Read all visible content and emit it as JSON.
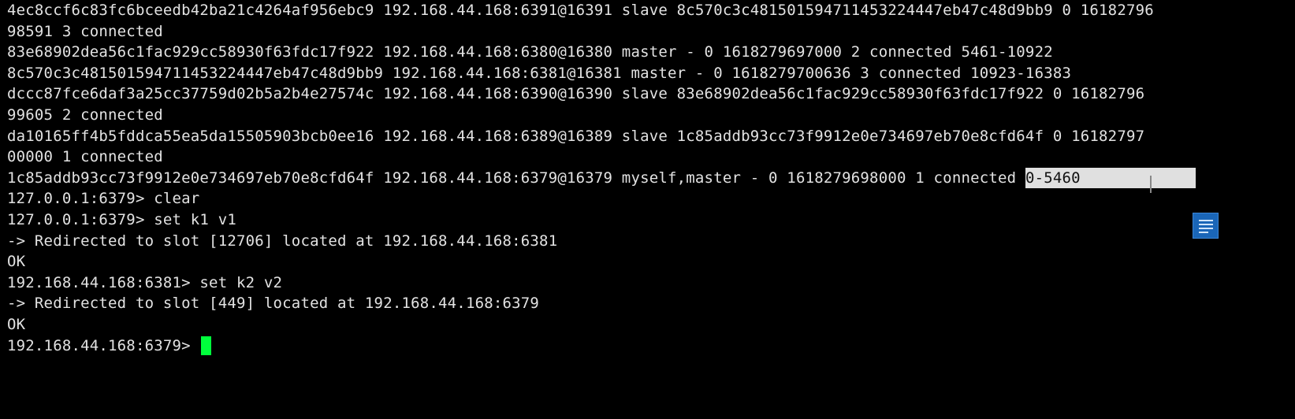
{
  "terminal": {
    "lines": [
      "4ec8ccf6c83fc6bceedb42ba21c4264af956ebc9 192.168.44.168:6391@16391 slave 8c570c3c481501594711453224447eb47c48d9bb9 0 16182796",
      "98591 3 connected",
      "83e68902dea56c1fac929cc58930f63fdc17f922 192.168.44.168:6380@16380 master - 0 1618279697000 2 connected 5461-10922",
      "8c570c3c481501594711453224447eb47c48d9bb9 192.168.44.168:6381@16381 master - 0 1618279700636 3 connected 10923-16383",
      "dccc87fce6daf3a25cc37759d02b5a2b4e27574c 192.168.44.168:6390@16390 slave 83e68902dea56c1fac929cc58930f63fdc17f922 0 16182796",
      "99605 2 connected",
      "da10165ff4b5fddca55ea5da15505903bcb0ee16 192.168.44.168:6389@16389 slave 1c85addb93cc73f9912e0e734697eb70e8cfd64f 0 16182797",
      "00000 1 connected"
    ],
    "myself_line_prefix": "1c85addb93cc73f9912e0e734697eb70e8cfd64f 192.168.44.168:6379@16379 myself,master - 0 1618279698000 1 connected ",
    "selected_text": "0-5460",
    "lines_after": [
      "127.0.0.1:6379> clear",
      "127.0.0.1:6379> set k1 v1",
      "-> Redirected to slot [12706] located at 192.168.44.168:6381",
      "OK",
      "192.168.44.168:6381> set k2 v2",
      "-> Redirected to slot [449] located at 192.168.44.168:6379",
      "OK"
    ],
    "prompt": "192.168.44.168:6379> ",
    "cursor_color": "#00ff3c",
    "background_color": "#000000",
    "text_color": "#e2e2e2",
    "selection_color": "#e0e0e0"
  },
  "overlay": {
    "icon": "notes-icon",
    "icon_color": "#1a66b8"
  }
}
